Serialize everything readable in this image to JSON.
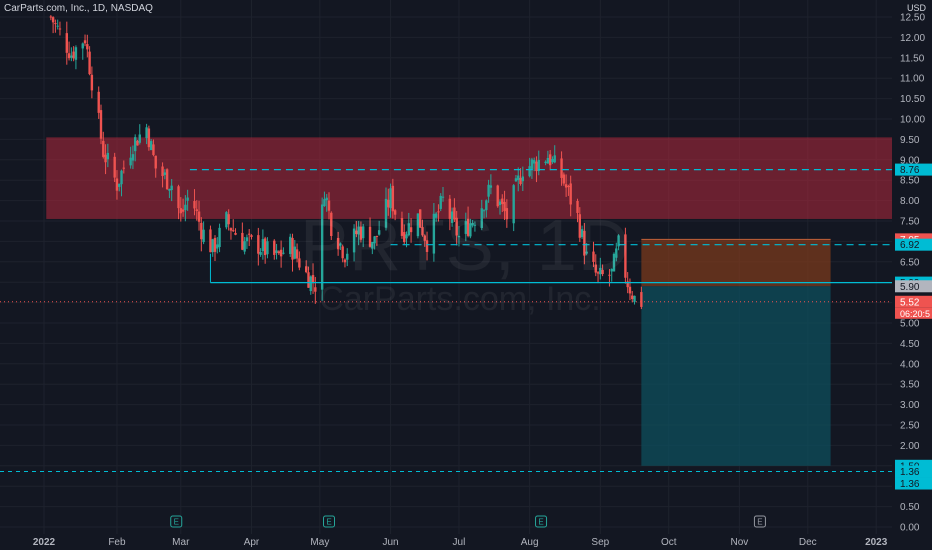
{
  "header": {
    "symbol_title": "CarParts.com, Inc., 1D, NASDAQ"
  },
  "currency_label": "USD",
  "watermark": {
    "ticker": "PRTS, 1D",
    "name": "CarParts.com, Inc."
  },
  "colors": {
    "up": "#26a69a",
    "down": "#ef5350",
    "cyan": "#00bcd4",
    "resistance_zone": "#b2283c",
    "stop_zone": "#7a3a1c",
    "target_zone": "#0d4f5c",
    "grid": "#1e222d",
    "background": "#131722"
  },
  "chart_data": {
    "type": "candlestick",
    "title": "CarParts.com, Inc., 1D, NASDAQ",
    "ylim": [
      0,
      12.6
    ],
    "y_ticks": [
      "0.00",
      "0.50",
      "1.00",
      "1.50",
      "2.00",
      "2.50",
      "3.00",
      "3.50",
      "4.00",
      "4.50",
      "5.00",
      "5.50",
      "6.00",
      "6.50",
      "7.00",
      "7.50",
      "8.00",
      "8.50",
      "9.00",
      "9.50",
      "10.00",
      "10.50",
      "11.00",
      "11.50",
      "12.00",
      "12.50"
    ],
    "x_ticks": [
      "2022",
      "Feb",
      "Mar",
      "Apr",
      "May",
      "Jun",
      "Jul",
      "Aug",
      "Sep",
      "Oct",
      "Nov",
      "Dec",
      "2023"
    ],
    "price_path": [
      [
        "2022-01-03",
        12.5
      ],
      [
        "2022-01-12",
        11.6
      ],
      [
        "2022-01-18",
        12.0
      ],
      [
        "2022-01-26",
        9.2
      ],
      [
        "2022-02-01",
        8.4
      ],
      [
        "2022-02-08",
        9.4
      ],
      [
        "2022-02-14",
        9.8
      ],
      [
        "2022-02-18",
        8.8
      ],
      [
        "2022-02-25",
        8.4
      ],
      [
        "2022-03-01",
        7.6
      ],
      [
        "2022-03-05",
        8.2
      ],
      [
        "2022-03-10",
        7.3
      ],
      [
        "2022-03-15",
        6.8
      ],
      [
        "2022-03-21",
        7.5
      ],
      [
        "2022-03-28",
        7.0
      ],
      [
        "2022-04-04",
        6.9
      ],
      [
        "2022-04-12",
        6.6
      ],
      [
        "2022-04-18",
        6.9
      ],
      [
        "2022-04-25",
        6.2
      ],
      [
        "2022-04-29",
        5.95
      ],
      [
        "2022-05-03",
        8.3
      ],
      [
        "2022-05-06",
        7.4
      ],
      [
        "2022-05-12",
        6.7
      ],
      [
        "2022-05-18",
        7.3
      ],
      [
        "2022-05-25",
        7.0
      ],
      [
        "2022-06-01",
        8.1
      ],
      [
        "2022-06-06",
        7.2
      ],
      [
        "2022-06-13",
        7.6
      ],
      [
        "2022-06-17",
        7.0
      ],
      [
        "2022-06-24",
        8.0
      ],
      [
        "2022-07-01",
        7.1
      ],
      [
        "2022-07-08",
        7.6
      ],
      [
        "2022-07-15",
        8.3
      ],
      [
        "2022-07-22",
        7.6
      ],
      [
        "2022-07-29",
        8.8
      ],
      [
        "2022-08-03",
        8.9
      ],
      [
        "2022-08-09",
        9.1
      ],
      [
        "2022-08-15",
        8.6
      ],
      [
        "2022-08-22",
        7.6
      ],
      [
        "2022-08-26",
        6.6
      ],
      [
        "2022-08-31",
        6.1
      ],
      [
        "2022-09-06",
        6.2
      ],
      [
        "2022-09-09",
        6.9
      ],
      [
        "2022-09-13",
        6.0
      ],
      [
        "2022-09-16",
        5.6
      ],
      [
        "2022-09-19",
        5.52
      ]
    ],
    "levels": [
      {
        "name": "upper_resistance",
        "value": 8.76,
        "label": "8.76",
        "style": "dashed"
      },
      {
        "name": "entry_level",
        "value": 6.92,
        "label": "6.92",
        "style": "dashed"
      },
      {
        "name": "support",
        "value": 5.99,
        "label": "5.99",
        "style": "solid"
      },
      {
        "name": "target_level",
        "value": 1.36,
        "label": "1.36",
        "style": "dashed"
      },
      {
        "name": "last_price",
        "value": 5.52,
        "label": "5.52",
        "style": "dotted"
      }
    ],
    "price_labels": {
      "stop_value": "7.05",
      "entry_value": "5.90",
      "last_price": "5.52",
      "countdown": "06:20:5",
      "target_value": "1.50",
      "target_level": "1.36",
      "target_level_2": "1.36"
    },
    "zones": [
      {
        "name": "resistance_zone",
        "from": 7.55,
        "to": 9.55,
        "start": "2022-01-01",
        "end": "2023-01-15"
      },
      {
        "name": "stop_zone",
        "from": 5.9,
        "to": 7.05,
        "start": "2022-09-19",
        "end": "2022-12-11"
      },
      {
        "name": "target_zone",
        "from": 1.5,
        "to": 5.9,
        "start": "2022-09-19",
        "end": "2022-12-11"
      }
    ],
    "earnings_markers": [
      {
        "date": "2022-02-27",
        "label": "E"
      },
      {
        "date": "2022-05-05",
        "label": "E"
      },
      {
        "date": "2022-08-06",
        "label": "E"
      },
      {
        "date": "2022-11-10",
        "label": "E"
      }
    ]
  }
}
